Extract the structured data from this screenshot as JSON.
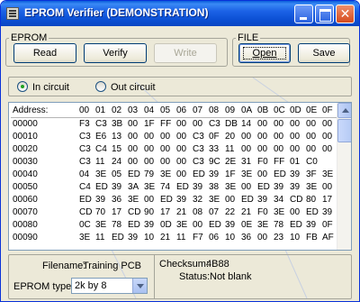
{
  "window": {
    "title": "EPROM Verifier (DEMONSTRATION)"
  },
  "eprom_group": {
    "label": "EPROM",
    "read": "Read",
    "verify": "Verify",
    "write": "Write"
  },
  "file_group": {
    "label": "FILE",
    "open": "Open",
    "save": "Save"
  },
  "mode": {
    "in_circuit": "In circuit",
    "out_circuit": "Out circuit",
    "selected": "in_circuit"
  },
  "hex_grid": {
    "header_label": "Address:",
    "columns": [
      "00",
      "01",
      "02",
      "03",
      "04",
      "05",
      "06",
      "07",
      "08",
      "09",
      "0A",
      "0B",
      "0C",
      "0D",
      "0E",
      "0F"
    ],
    "rows": [
      {
        "address": "00000",
        "bytes": [
          "F3",
          "C3",
          "3B",
          "00",
          "1F",
          "FF",
          "00",
          "00",
          "C3",
          "DB",
          "14",
          "00",
          "00",
          "00",
          "00",
          "00"
        ]
      },
      {
        "address": "00010",
        "bytes": [
          "C3",
          "E6",
          "13",
          "00",
          "00",
          "00",
          "00",
          "C3",
          "0F",
          "20",
          "00",
          "00",
          "00",
          "00",
          "00",
          "00"
        ]
      },
      {
        "address": "00020",
        "bytes": [
          "C3",
          "C4",
          "15",
          "00",
          "00",
          "00",
          "00",
          "C3",
          "33",
          "11",
          "00",
          "00",
          "00",
          "00",
          "00",
          "00"
        ]
      },
      {
        "address": "00030",
        "bytes": [
          "C3",
          "11",
          "24",
          "00",
          "00",
          "00",
          "00",
          "C3",
          "9C",
          "2E",
          "31",
          "F0",
          "FF",
          "01",
          "C0"
        ]
      },
      {
        "address": "00040",
        "bytes": [
          "04",
          "3E",
          "05",
          "ED",
          "79",
          "3E",
          "00",
          "ED",
          "39",
          "1F",
          "3E",
          "00",
          "ED",
          "39",
          "3F",
          "3E"
        ]
      },
      {
        "address": "00050",
        "bytes": [
          "C4",
          "ED",
          "39",
          "3A",
          "3E",
          "74",
          "ED",
          "39",
          "38",
          "3E",
          "00",
          "ED",
          "39",
          "39",
          "3E",
          "00"
        ]
      },
      {
        "address": "00060",
        "bytes": [
          "ED",
          "39",
          "36",
          "3E",
          "00",
          "ED",
          "39",
          "32",
          "3E",
          "00",
          "ED",
          "39",
          "34",
          "CD",
          "80",
          "17"
        ]
      },
      {
        "address": "00070",
        "bytes": [
          "CD",
          "70",
          "17",
          "CD",
          "90",
          "17",
          "21",
          "08",
          "07",
          "22",
          "21",
          "F0",
          "3E",
          "00",
          "ED",
          "39"
        ]
      },
      {
        "address": "00080",
        "bytes": [
          "0C",
          "3E",
          "78",
          "ED",
          "39",
          "0D",
          "3E",
          "00",
          "ED",
          "39",
          "0E",
          "3E",
          "78",
          "ED",
          "39",
          "0F"
        ]
      },
      {
        "address": "00090",
        "bytes": [
          "3E",
          "11",
          "ED",
          "39",
          "10",
          "21",
          "11",
          "F7",
          "06",
          "10",
          "36",
          "00",
          "23",
          "10",
          "FB",
          "AF"
        ]
      }
    ]
  },
  "info": {
    "filename_label": "Filename:",
    "filename": "Training PCB",
    "eprom_type_label": "EPROM type",
    "eprom_type": "2k by 8",
    "checksum_label": "Checksum:",
    "checksum": "4B88",
    "status_label": "Status:",
    "status": "Not blank"
  },
  "colors": {
    "titlebar": "#0b4fd3",
    "window_bg": "#ece9d8",
    "radio_dot": "#21a121"
  }
}
